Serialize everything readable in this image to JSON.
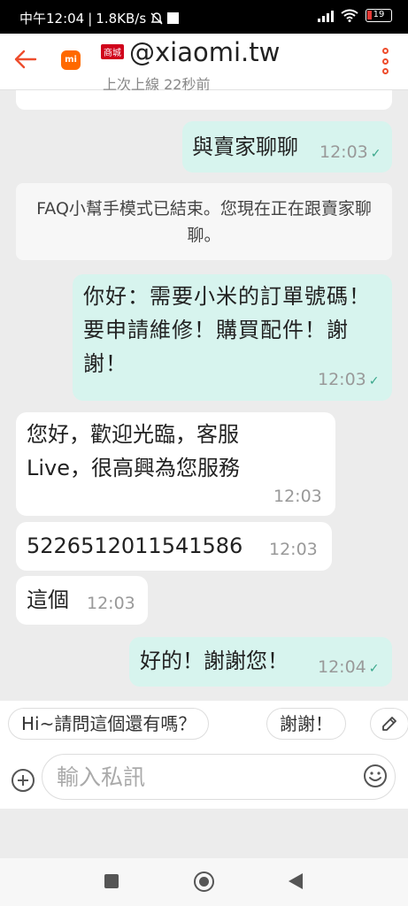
{
  "status_bar": {
    "time": "中午12:04",
    "speed": "1.8KB/s",
    "battery": "19"
  },
  "header": {
    "shop_badge": "商城",
    "shop_name": "@xiaomi.tw",
    "last_seen": "上次上線 22秒前",
    "logo_text": "mi",
    "accent_color": "#ee4d2d"
  },
  "messages": [
    {
      "type": "out",
      "text": "與賣家聊聊",
      "time": "12:03"
    },
    {
      "type": "system",
      "text": "FAQ小幫手模式已結束。您現在正在跟賣家聊聊。"
    },
    {
      "type": "out",
      "text": "你好：需要小米的訂單號碼！要申請維修！購買配件！謝謝！",
      "time": "12:03"
    },
    {
      "type": "in",
      "text": "您好，歡迎光臨，客服Live，很高興為您服務",
      "time": "12:03"
    },
    {
      "type": "in",
      "text": "5226512011541586",
      "time": "12:03"
    },
    {
      "type": "in",
      "text": "這個",
      "time": "12:03"
    },
    {
      "type": "out",
      "text": "好的！謝謝您！",
      "time": "12:04"
    }
  ],
  "quick_replies": [
    "Hi~請問這個還有嗎？",
    "謝謝！"
  ],
  "composer": {
    "placeholder": "輸入私訊"
  },
  "colors": {
    "outgoing_bubble": "#d7f4ee",
    "incoming_bubble": "#ffffff",
    "read_tick": "#3aa78b"
  }
}
